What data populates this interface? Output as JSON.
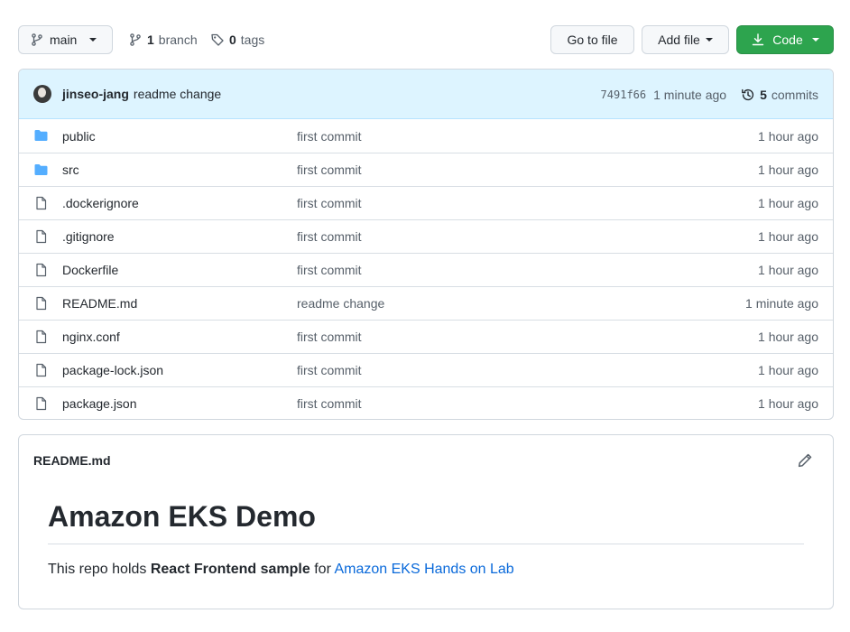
{
  "toolbar": {
    "branch_label": "main",
    "branch_count": "1",
    "branch_word": "branch",
    "tag_count": "0",
    "tag_word": "tags",
    "goto_label": "Go to file",
    "addfile_label": "Add file",
    "code_label": "Code",
    "code_color": "#2da44e"
  },
  "commit": {
    "author": "jinseo-jang",
    "message": "readme change",
    "sha": "7491f66",
    "time": "1 minute ago",
    "count": "5",
    "count_word": "commits"
  },
  "files": [
    {
      "name": "public",
      "type": "folder",
      "commit": "first commit",
      "age": "1 hour ago"
    },
    {
      "name": "src",
      "type": "folder",
      "commit": "first commit",
      "age": "1 hour ago"
    },
    {
      "name": ".dockerignore",
      "type": "file",
      "commit": "first commit",
      "age": "1 hour ago"
    },
    {
      "name": ".gitignore",
      "type": "file",
      "commit": "first commit",
      "age": "1 hour ago"
    },
    {
      "name": "Dockerfile",
      "type": "file",
      "commit": "first commit",
      "age": "1 hour ago"
    },
    {
      "name": "README.md",
      "type": "file",
      "commit": "readme change",
      "age": "1 minute ago"
    },
    {
      "name": "nginx.conf",
      "type": "file",
      "commit": "first commit",
      "age": "1 hour ago"
    },
    {
      "name": "package-lock.json",
      "type": "file",
      "commit": "first commit",
      "age": "1 hour ago"
    },
    {
      "name": "package.json",
      "type": "file",
      "commit": "first commit",
      "age": "1 hour ago"
    }
  ],
  "readme": {
    "filename": "README.md",
    "title": "Amazon EKS Demo",
    "text_before": "This repo holds ",
    "text_bold": "React Frontend sample",
    "text_mid": " for ",
    "link_text": "Amazon EKS Hands on Lab"
  }
}
